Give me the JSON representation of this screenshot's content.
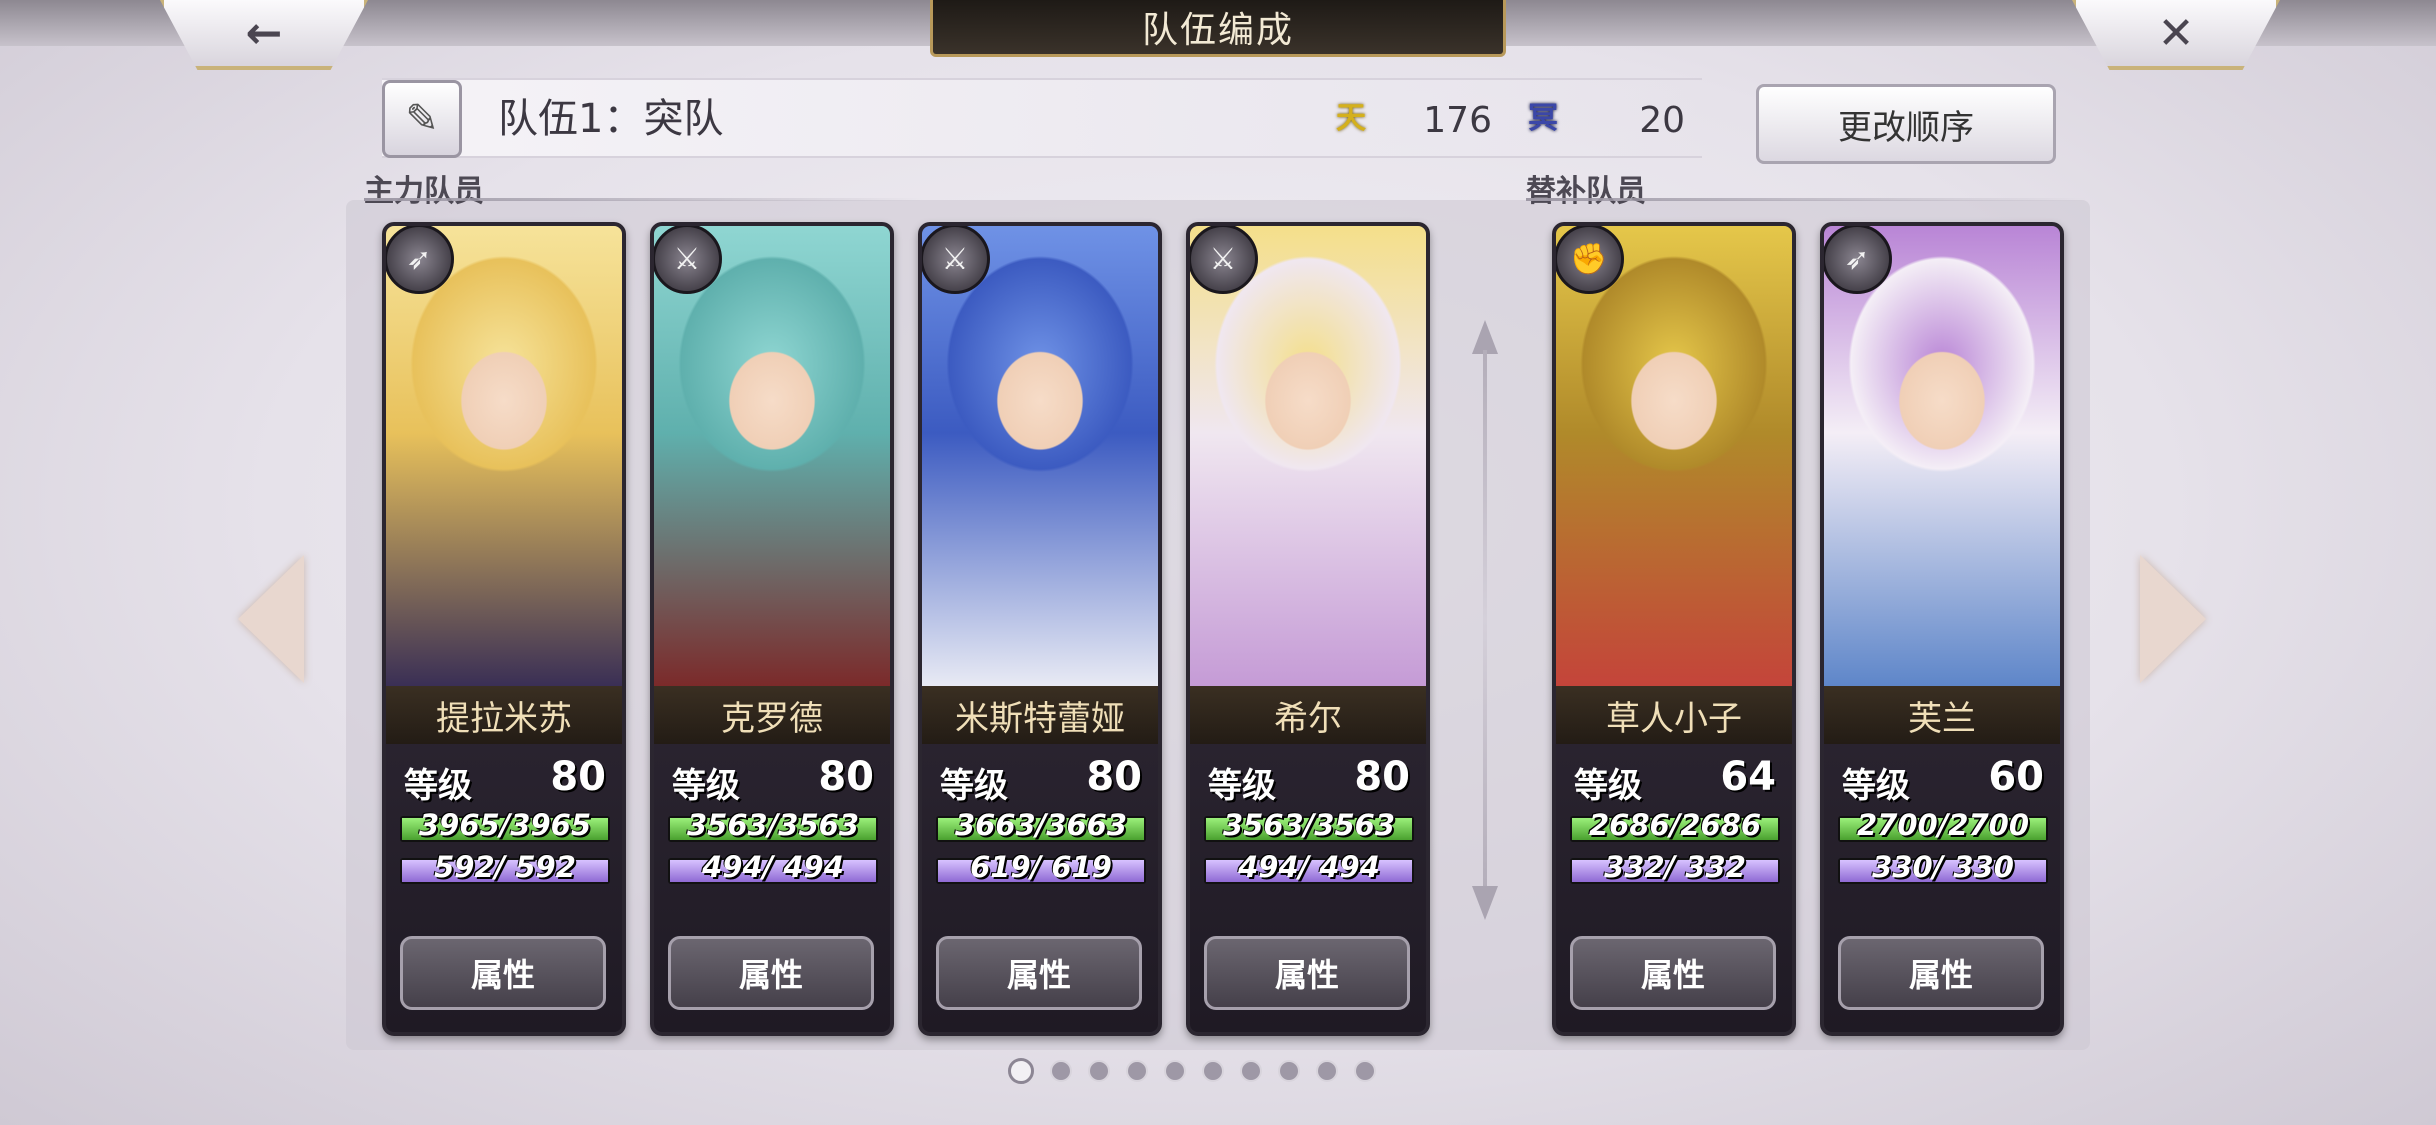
{
  "header": {
    "title": "队伍编成",
    "back_label": "←",
    "close_label": "✕"
  },
  "team": {
    "name": "队伍1：突队",
    "stat1_icon": "天",
    "stat1_value": "176",
    "stat2_icon": "冥",
    "stat2_value": "20",
    "reorder_label": "更改顺序"
  },
  "sections": {
    "main_label": "主力队员",
    "sub_label": "替补队员"
  },
  "members": [
    {
      "name": "提拉米苏",
      "weapon_icon": "spear-icon",
      "weapon_glyph": "➶",
      "level_label": "等级",
      "level": "80",
      "hp": "3965/3965",
      "hp_ratio": 1.0,
      "mp": "592/ 592",
      "mp_ratio": 1.0,
      "button": "属性",
      "palette": [
        "#f6e39a",
        "#e8c15b",
        "#3a2f55"
      ]
    },
    {
      "name": "克罗德",
      "weapon_icon": "crossbow-icon",
      "weapon_glyph": "⚔",
      "level_label": "等级",
      "level": "80",
      "hp": "3563/3563",
      "hp_ratio": 1.0,
      "mp": "494/ 494",
      "mp_ratio": 1.0,
      "button": "属性",
      "palette": [
        "#8fd6d2",
        "#5fb0ad",
        "#7b2a2a"
      ]
    },
    {
      "name": "米斯特蕾娅",
      "weapon_icon": "crossbow-icon",
      "weapon_glyph": "⚔",
      "level_label": "等级",
      "level": "80",
      "hp": "3663/3663",
      "hp_ratio": 1.0,
      "mp": "619/ 619",
      "mp_ratio": 1.0,
      "button": "属性",
      "palette": [
        "#6f92e6",
        "#3c5bc1",
        "#e8eaf4"
      ]
    },
    {
      "name": "希尔",
      "weapon_icon": "crossbow-icon",
      "weapon_glyph": "⚔",
      "level_label": "等级",
      "level": "80",
      "hp": "3563/3563",
      "hp_ratio": 1.0,
      "mp": "494/ 494",
      "mp_ratio": 1.0,
      "button": "属性",
      "palette": [
        "#f4df8a",
        "#f0e7f0",
        "#c59bd6"
      ]
    },
    {
      "name": "草人小子",
      "weapon_icon": "fist-icon",
      "weapon_glyph": "✊",
      "level_label": "等级",
      "level": "64",
      "hp": "2686/2686",
      "hp_ratio": 1.0,
      "mp": "332/ 332",
      "mp_ratio": 1.0,
      "button": "属性",
      "palette": [
        "#e5c74a",
        "#b08a2a",
        "#c4443a"
      ]
    },
    {
      "name": "芙兰",
      "weapon_icon": "spear-icon",
      "weapon_glyph": "➶",
      "level_label": "等级",
      "level": "60",
      "hp": "2700/2700",
      "hp_ratio": 1.0,
      "mp": "330/ 330",
      "mp_ratio": 1.0,
      "button": "属性",
      "palette": [
        "#b985d6",
        "#f4eef6",
        "#5e86c9"
      ]
    }
  ],
  "pager": {
    "count": 10,
    "active_index": 0
  }
}
